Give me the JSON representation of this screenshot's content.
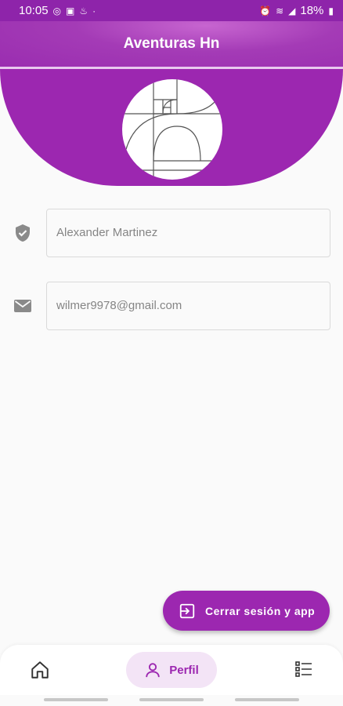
{
  "status_bar": {
    "time": "10:05",
    "battery": "18%",
    "left_icons": [
      "instagram-icon",
      "image-icon",
      "notification-icon"
    ],
    "right_icons": [
      "alarm-icon",
      "wifi-icon",
      "signal-icon",
      "battery-icon"
    ]
  },
  "app_bar": {
    "title": "Aventuras Hn"
  },
  "colors": {
    "primary": "#9c27b0",
    "primary_light": "#f3e4f6",
    "field_border": "#dadada"
  },
  "profile": {
    "name_field": {
      "value": "Alexander Martinez",
      "icon": "shield-check-icon"
    },
    "email_field": {
      "value": "wilmer9978@gmail.com",
      "icon": "email-icon"
    }
  },
  "fab": {
    "label": "Cerrar sesión y app",
    "icon": "logout-icon"
  },
  "bottom_nav": {
    "items": [
      {
        "icon": "home-icon",
        "label": ""
      },
      {
        "icon": "person-icon",
        "label": "Perfil",
        "selected": true
      },
      {
        "icon": "list-icon",
        "label": ""
      }
    ]
  }
}
